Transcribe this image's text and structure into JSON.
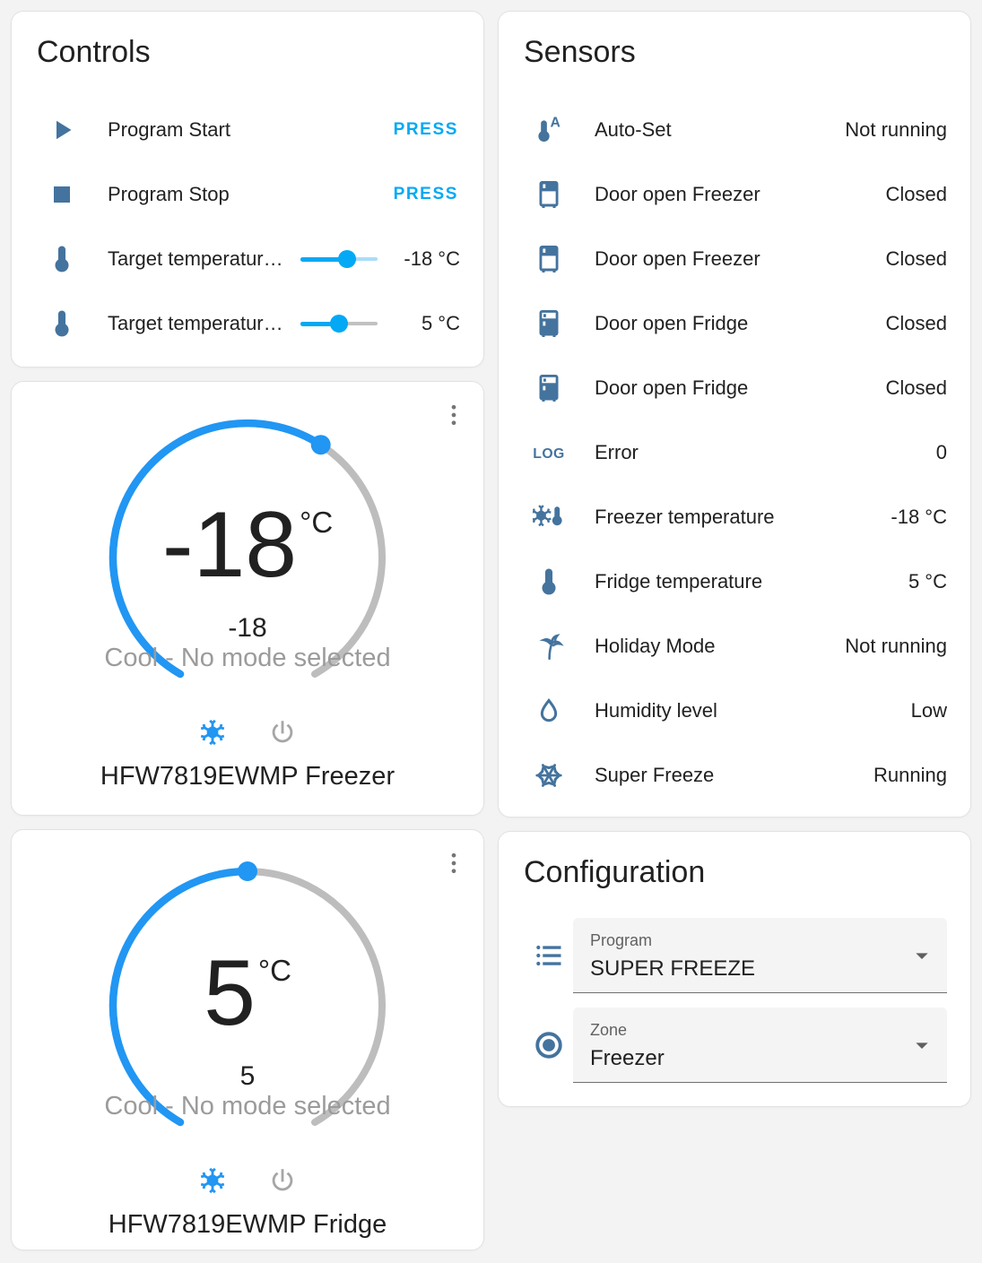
{
  "colors": {
    "accent_blue": "#03a9f4",
    "dial_blue": "#2196f3",
    "dial_gray": "#bdbdbd",
    "icon_blue": "#44739e",
    "track_rest_blue": "#aadcf8",
    "track_rest_gray": "#c1c1c1",
    "inactive_gray": "#a6a6a6"
  },
  "controls": {
    "title": "Controls",
    "rows": [
      {
        "icon": "play-icon",
        "label": "Program Start",
        "type": "press",
        "press_label": "PRESS"
      },
      {
        "icon": "stop-icon",
        "label": "Program Stop",
        "type": "press",
        "press_label": "PRESS"
      },
      {
        "icon": "thermometer-icon",
        "label": "Target temperatur…",
        "type": "slider",
        "value": "-18 °C",
        "percent": 60,
        "rest": "blue"
      },
      {
        "icon": "thermometer-icon",
        "label": "Target temperatur…",
        "type": "slider",
        "value": "5 °C",
        "percent": 50,
        "rest": "gray"
      }
    ]
  },
  "sensors": {
    "title": "Sensors",
    "rows": [
      {
        "icon": "thermometer-auto-icon",
        "label": "Auto-Set",
        "value": "Not running"
      },
      {
        "icon": "fridge-bottom-open-icon",
        "label": "Door open Freezer",
        "value": "Closed"
      },
      {
        "icon": "fridge-bottom-open-icon",
        "label": "Door open Freezer",
        "value": "Closed"
      },
      {
        "icon": "fridge-top-open-icon",
        "label": "Door open Fridge",
        "value": "Closed"
      },
      {
        "icon": "fridge-top-open-icon",
        "label": "Door open Fridge",
        "value": "Closed"
      },
      {
        "icon": "log-icon",
        "label": "Error",
        "value": "0"
      },
      {
        "icon": "snowflake-thermometer-icon",
        "label": "Freezer temperature",
        "value": "-18 °C"
      },
      {
        "icon": "thermometer-icon",
        "label": "Fridge temperature",
        "value": "5 °C"
      },
      {
        "icon": "palm-tree-icon",
        "label": "Holiday Mode",
        "value": "Not running"
      },
      {
        "icon": "water-outline-icon",
        "label": "Humidity level",
        "value": "Low"
      },
      {
        "icon": "snowflake-variant-icon",
        "label": "Super Freeze",
        "value": "Running"
      }
    ]
  },
  "thermostats": [
    {
      "name": "HFW7819EWMP Freezer",
      "target": "-18",
      "unit": "°C",
      "current": "-18",
      "status": "Cool - No mode selected",
      "percent": 61
    },
    {
      "name": "HFW7819EWMP Fridge",
      "target": "5",
      "unit": "°C",
      "current": "5",
      "status": "Cool - No mode selected",
      "percent": 50
    }
  ],
  "configuration": {
    "title": "Configuration",
    "fields": [
      {
        "icon": "format-list-icon",
        "label": "Program",
        "value": "SUPER FREEZE"
      },
      {
        "icon": "radiobox-icon",
        "label": "Zone",
        "value": "Freezer"
      }
    ]
  }
}
